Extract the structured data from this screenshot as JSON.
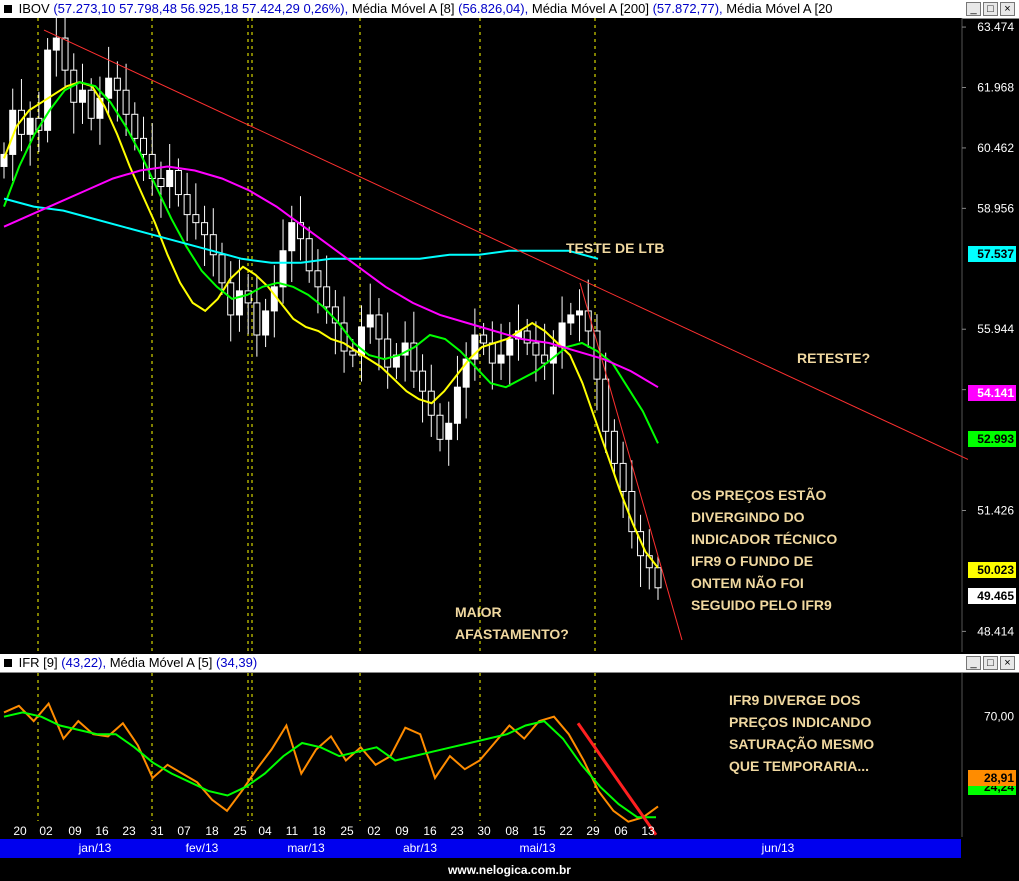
{
  "main_header": {
    "name": "IBOV",
    "values": "(57.273,10  57.798,48  56.925,18  57.424,29  0,26%),",
    "ma1_name": "Média Móvel A [8]",
    "ma1_values": "(56.826,04),",
    "ma2_name": "Média Móvel A [200]",
    "ma2_values": "(57.872,77),",
    "ma3_name": "Média Móvel A [20"
  },
  "ifr_header": {
    "name": "IFR [9]",
    "values": "(43,22),",
    "ma_name": "Média Móvel A [5]",
    "ma_values": "(34,39)"
  },
  "window_buttons": {
    "minimize": "_",
    "restore": "□",
    "close": "×"
  },
  "annotations": {
    "teste_ltb": "TESTE DE LTB",
    "reteste": "RETESTE?",
    "maior_afastamento": "MAIOR\nAFASTAMENTO?",
    "divergindo": "OS PREÇOS ESTÃO\nDIVERGINDO DO\nINDICADOR TÉCNICO\nIFR9 O FUNDO DE\nONTEM NÃO FOI\nSEGUIDO PELO IFR9",
    "ifr_diverge": "IFR9 DIVERGE DOS\nPREÇOS INDICANDO\nSATURAÇÃO MESMO\nQUE TEMPORARIA..."
  },
  "price_badges": [
    {
      "value": "57.537",
      "color": "#00ffff"
    },
    {
      "value": "54.141",
      "color": "#ff00ff"
    },
    {
      "value": "52.993",
      "color": "#00ff00"
    },
    {
      "value": "50.023",
      "color": "#ffff00"
    },
    {
      "value": "49.465",
      "color": "#ffffff"
    }
  ],
  "ifr_badges": [
    {
      "value": "28,91",
      "color": "#ff8c00"
    },
    {
      "value": "24,24",
      "color": "#00ff00"
    }
  ],
  "month_labels": [
    "jan/13",
    "fev/13",
    "mar/13",
    "abr/13",
    "mai/13",
    "jun/13"
  ],
  "footer": "www.nelogica.com.br",
  "colors": {
    "candle": "#ffffff",
    "ma8": "#ffff00",
    "ma20": "#00ff00",
    "ma50": "#ff00ff",
    "ma200": "#00ffff",
    "trendline": "#ff3030",
    "ifr": "#ff8c00",
    "ifr_ma": "#00ff00",
    "grid": "#ffff00"
  },
  "chart_data": [
    {
      "type": "candlestick",
      "title": "IBOV",
      "ylim": [
        47900,
        63700
      ],
      "yticks": [
        63474,
        61968,
        60462,
        58956,
        55944,
        54438,
        51426,
        48414
      ],
      "ytick_labels": [
        "63.474",
        "61.968",
        "60.462",
        "58.956",
        "55.944",
        "54.438",
        "51.426",
        "48.414"
      ],
      "xtick_labels": [
        "20",
        "02",
        "09",
        "16",
        "23",
        "31",
        "07",
        "18",
        "25",
        "04",
        "11",
        "18",
        "25",
        "02",
        "09",
        "16",
        "23",
        "30",
        "08",
        "15",
        "22",
        "29",
        "06",
        "13"
      ],
      "close": [
        60300,
        61400,
        60800,
        61200,
        60900,
        62900,
        63200,
        62400,
        61600,
        61900,
        61200,
        61700,
        62200,
        61900,
        61300,
        60700,
        60300,
        59700,
        59500,
        59900,
        59300,
        58800,
        58600,
        58300,
        57800,
        57100,
        56300,
        56900,
        56600,
        55800,
        56400,
        57000,
        57900,
        58600,
        58200,
        57400,
        57000,
        56500,
        56100,
        55400,
        55300,
        56000,
        56300,
        55700,
        55000,
        55300,
        55600,
        54900,
        54400,
        53800,
        53200,
        53600,
        54500,
        55200,
        55800,
        55600,
        55100,
        55300,
        55700,
        55900,
        55600,
        55300,
        55100,
        55500,
        56100,
        56300,
        56400,
        55900,
        54700,
        53400,
        52600,
        51900,
        50900,
        50300,
        50000,
        49500
      ],
      "series": [
        {
          "name": "Média Móvel A [8]",
          "values": [
            60200,
            61000,
            61400,
            61600,
            61800,
            62000,
            62100,
            62000,
            61500,
            60800,
            60000,
            59300,
            58600,
            57800,
            57100,
            56600,
            56400,
            56700,
            57200,
            57500,
            57300,
            57000,
            56600,
            56200,
            56000,
            55900,
            55700,
            55600,
            55400,
            55200,
            55000,
            54700,
            54400,
            54200,
            54100,
            54400,
            54800,
            55200,
            55500,
            55600,
            55700,
            55900,
            56100,
            55900,
            55600,
            55300,
            54600,
            53700,
            52800,
            51900,
            51100,
            50400,
            50000
          ]
        },
        {
          "name": "Média Móvel A [20]",
          "values": [
            59000,
            60000,
            60800,
            61400,
            61900,
            62100,
            62000,
            61600,
            61000,
            60300,
            59500,
            58700,
            58000,
            57400,
            57000,
            56700,
            56800,
            57000,
            57100,
            57000,
            56800,
            56500,
            56100,
            55600,
            55300,
            55200,
            55300,
            55500,
            55800,
            55700,
            55400,
            55000,
            54600,
            54500,
            54700,
            54900,
            55200,
            55500,
            55600,
            55400,
            55100,
            54500,
            53900,
            53100
          ]
        },
        {
          "name": "Média Móvel A [200]",
          "values": [
            59200,
            59000,
            58900,
            58700,
            58500,
            58300,
            58100,
            57900,
            57700,
            57600,
            57600,
            57700,
            57700,
            57700,
            57700,
            57800,
            57800,
            57900,
            57900,
            57900,
            57700
          ]
        },
        {
          "name": "Média Móvel A [50]",
          "values": [
            58500,
            58800,
            59100,
            59400,
            59700,
            59900,
            60000,
            59900,
            59700,
            59400,
            59000,
            58500,
            58000,
            57500,
            57000,
            56600,
            56300,
            56100,
            55900,
            55700,
            55600,
            55400,
            55200,
            54900,
            54500
          ]
        }
      ],
      "trendlines": [
        {
          "from": [
            "02",
            63400
          ],
          "to": [
            "jun",
            52700
          ]
        },
        {
          "from": [
            "22",
            57100
          ],
          "to": [
            "jun",
            48200
          ]
        }
      ]
    },
    {
      "type": "line",
      "title": "IFR [9]",
      "ylim": [
        15,
        90
      ],
      "ytick_labels": [
        "70,00"
      ],
      "yticks": [
        70
      ],
      "series": [
        {
          "name": "IFR [9]",
          "values": [
            72,
            75,
            68,
            76,
            60,
            68,
            62,
            61,
            67,
            57,
            42,
            48,
            44,
            40,
            32,
            27,
            36,
            46,
            55,
            66,
            44,
            55,
            61,
            50,
            56,
            48,
            52,
            65,
            62,
            42,
            52,
            46,
            50,
            58,
            66,
            60,
            68,
            70,
            62,
            50,
            36,
            27,
            22,
            24,
            29
          ]
        },
        {
          "name": "Média Móvel A [5]",
          "values": [
            70,
            72,
            70,
            66,
            64,
            62,
            62,
            56,
            49,
            44,
            40,
            36,
            34,
            38,
            44,
            52,
            58,
            56,
            52,
            54,
            56,
            50,
            52,
            54,
            56,
            58,
            60,
            62,
            66,
            68,
            60,
            48,
            38,
            30,
            24,
            24
          ]
        }
      ]
    }
  ]
}
